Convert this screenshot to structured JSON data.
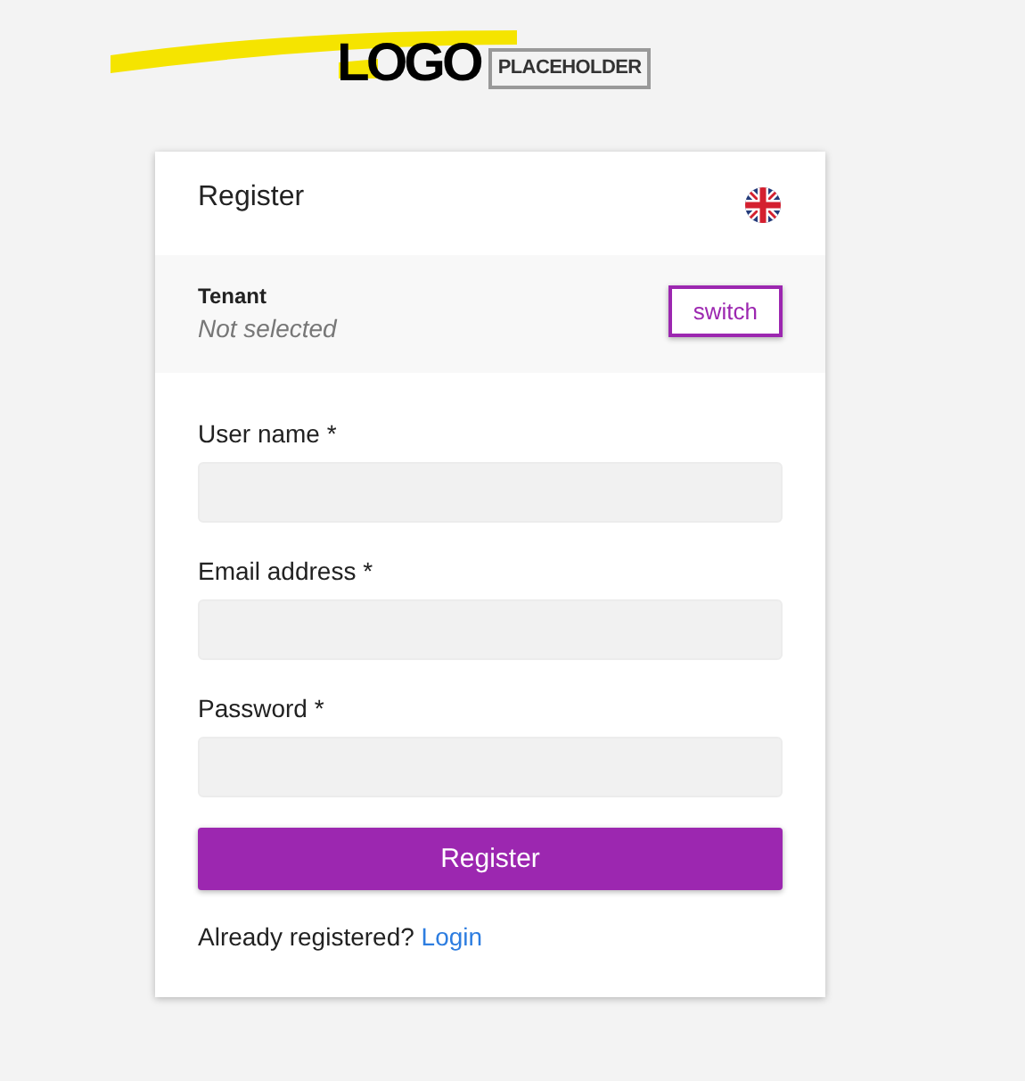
{
  "logo": {
    "main": "LOGO",
    "tag": "PLACEHOLDER"
  },
  "card": {
    "title": "Register"
  },
  "tenant": {
    "label": "Tenant",
    "value": "Not selected",
    "button": "switch"
  },
  "fields": [
    {
      "label": "User name *"
    },
    {
      "label": "Email address *"
    },
    {
      "label": "Password *"
    }
  ],
  "submit": "Register",
  "footer": {
    "text": "Already registered?",
    "link": "Login"
  }
}
